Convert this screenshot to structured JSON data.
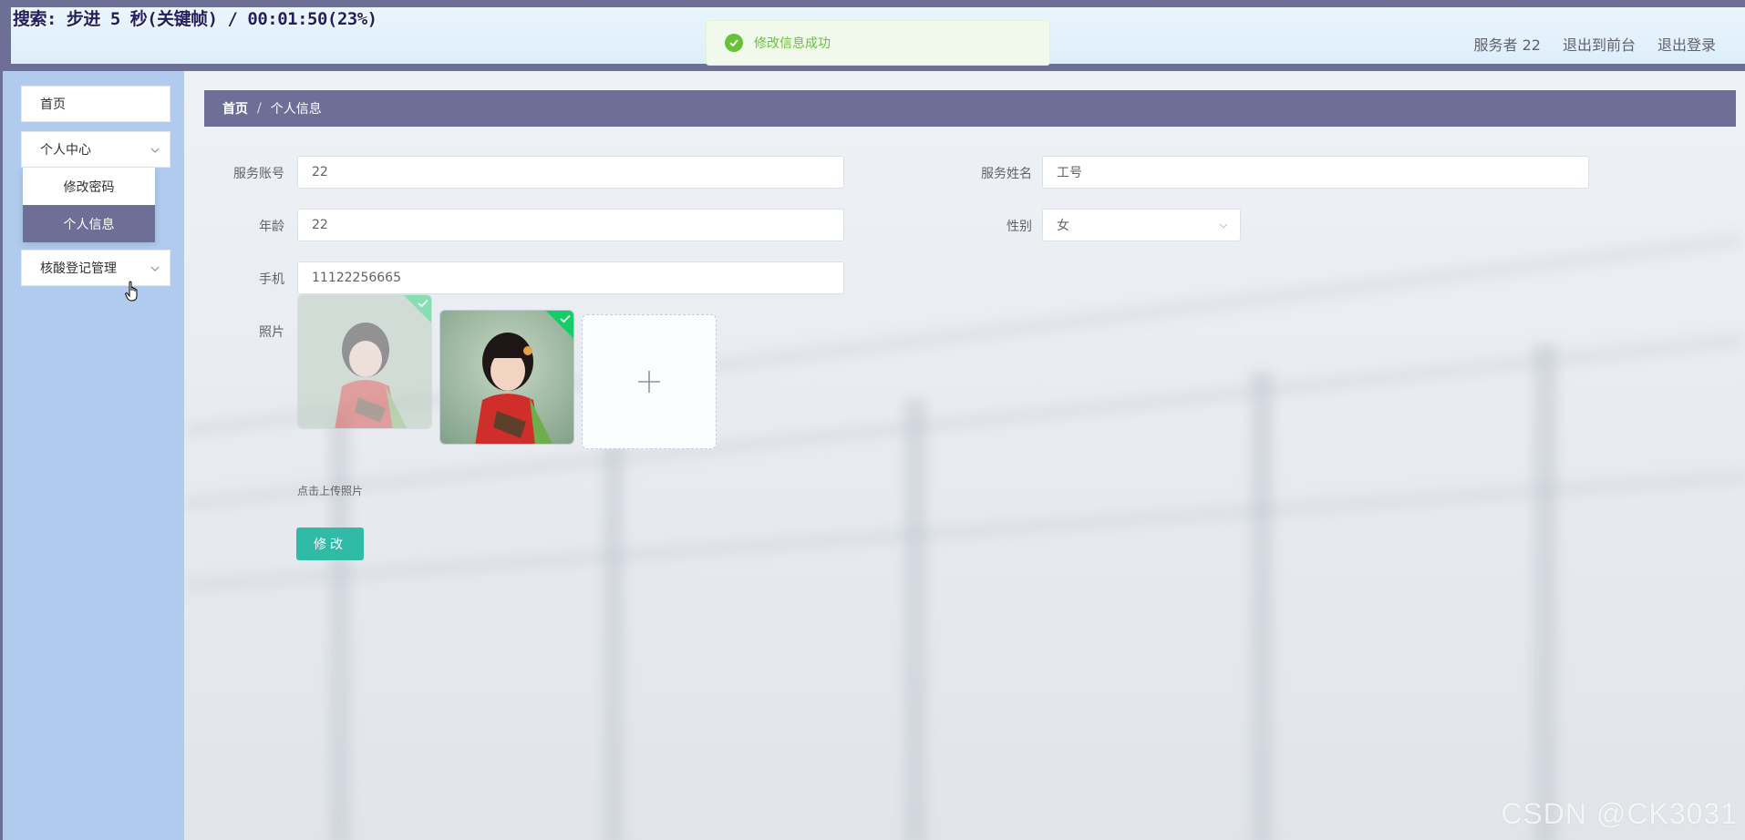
{
  "overlay": {
    "caption": "搜索: 步进 5 秒(关键帧) / 00:01:50(23%)"
  },
  "header": {
    "user_label": "服务者 22",
    "front_link": "退出到前台",
    "logout_link": "退出登录"
  },
  "toast": {
    "message": "修改信息成功",
    "type": "success"
  },
  "sidebar": {
    "items": [
      {
        "label": "首页"
      },
      {
        "label": "个人中心",
        "expanded": true,
        "children": [
          {
            "label": "修改密码"
          },
          {
            "label": "个人信息",
            "active": true
          }
        ]
      },
      {
        "label": "核酸登记管理"
      }
    ]
  },
  "breadcrumb": {
    "home": "首页",
    "separator": "/",
    "current": "个人信息"
  },
  "form": {
    "account": {
      "label": "服务账号",
      "value": "22"
    },
    "name": {
      "label": "服务姓名",
      "value": "工号"
    },
    "age": {
      "label": "年龄",
      "value": "22"
    },
    "gender": {
      "label": "性别",
      "value": "女"
    },
    "phone": {
      "label": "手机",
      "value": "11122256665"
    },
    "photo": {
      "label": "照片",
      "tip": "点击上传照片",
      "count": 2
    },
    "submit_label": "修改"
  },
  "watermark": "CSDN @CK3031",
  "colors": {
    "theme": "#6e6f96",
    "sidebar_bg": "#b0cbed",
    "button": "#2fbba6",
    "success": "#67c23a"
  }
}
